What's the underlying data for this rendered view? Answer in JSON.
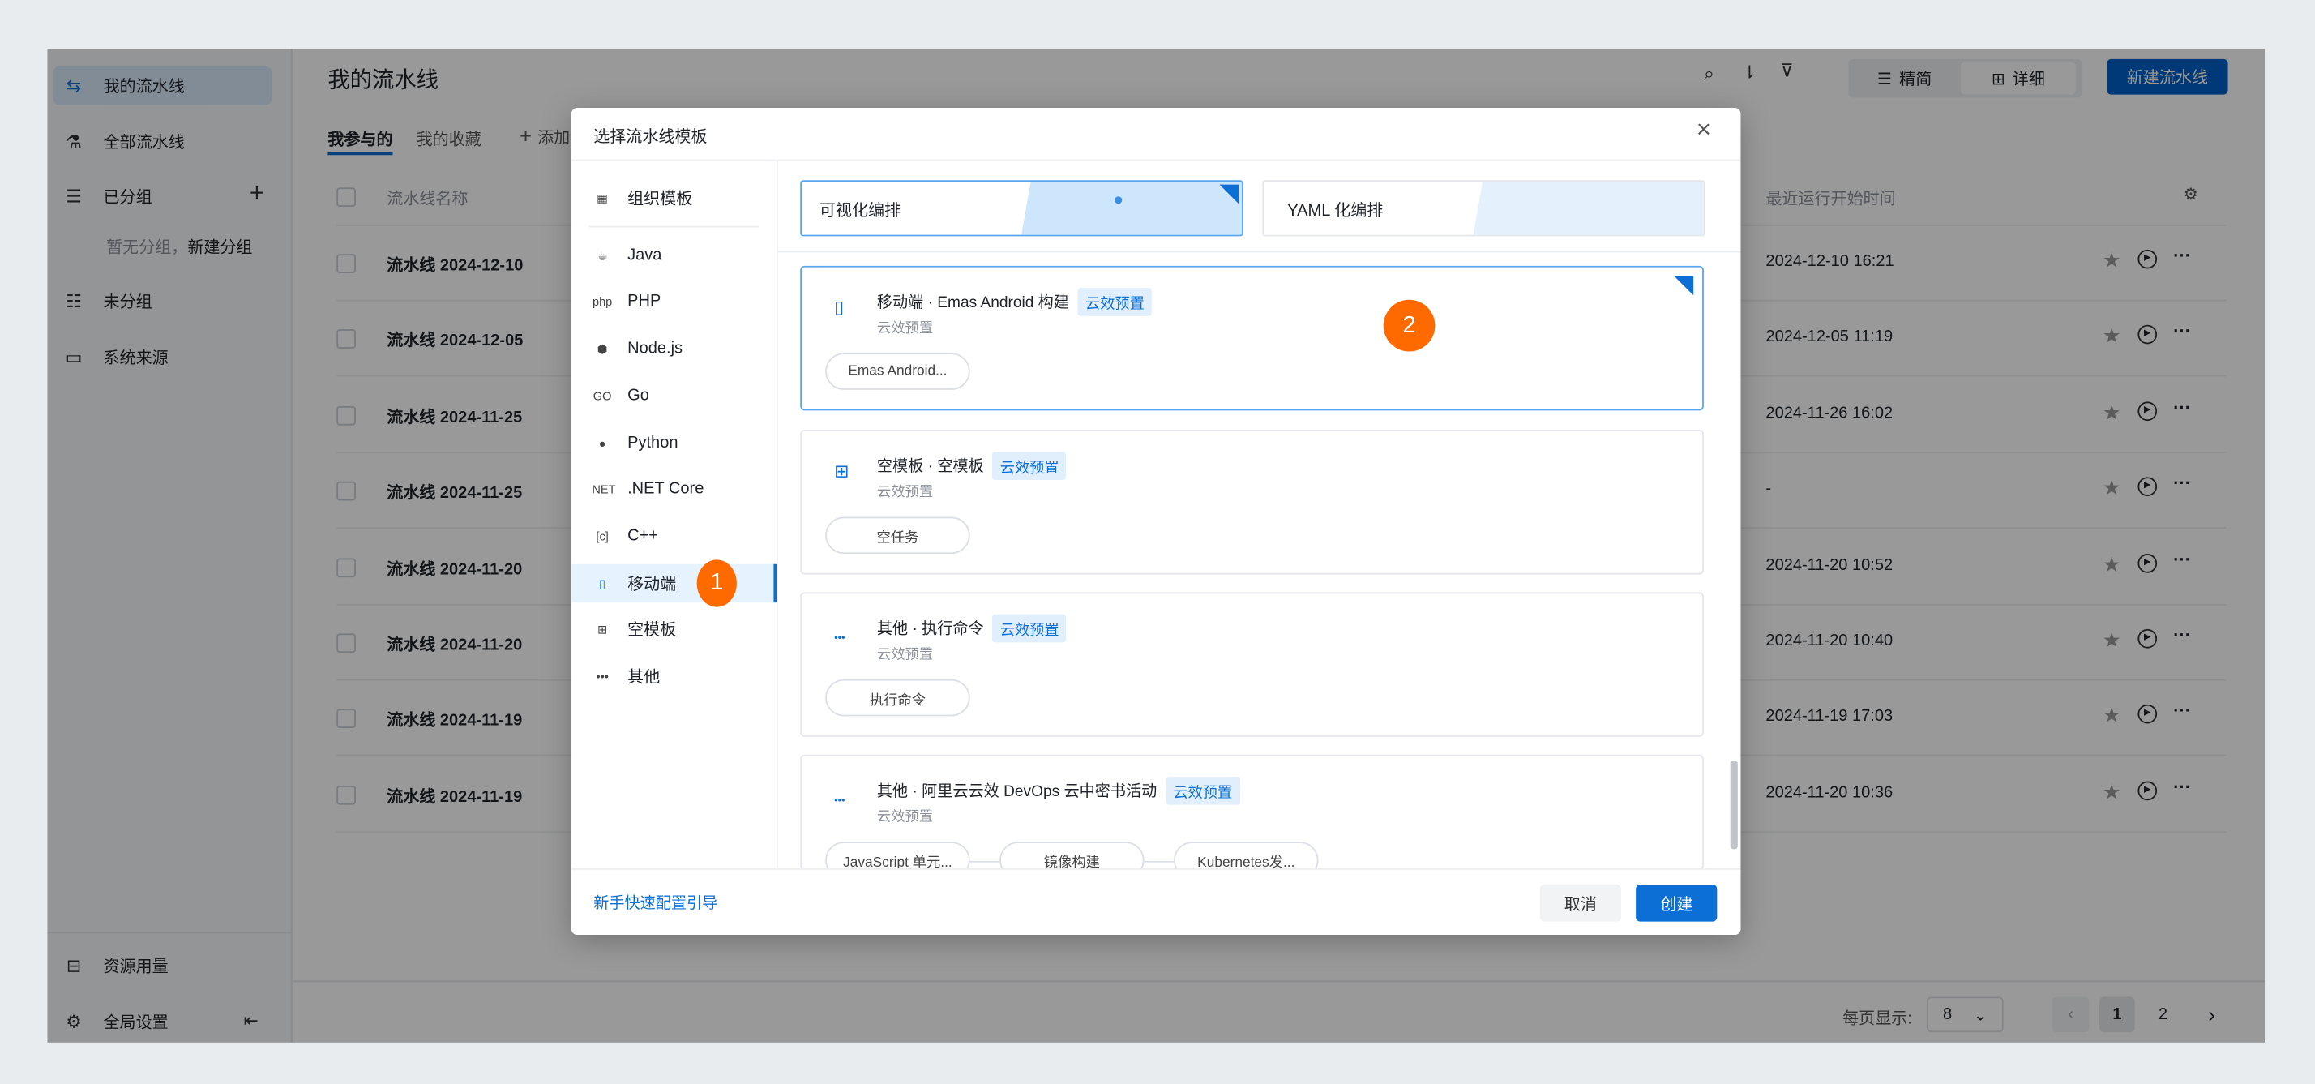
{
  "colors": {
    "accent": "#0b6fd6",
    "primary_button": "#0060c6",
    "step_badge": "#ff6a00",
    "background": "#e8ecef"
  },
  "sidebar": {
    "items": [
      {
        "label": "我的流水线",
        "icon": "pipeline-icon",
        "active": true
      },
      {
        "label": "全部流水线",
        "icon": "flask-icon"
      },
      {
        "label": "已分组",
        "icon": "group-list-icon"
      },
      {
        "label": "未分组",
        "icon": "ungrouped-icon"
      },
      {
        "label": "系统来源",
        "icon": "monitor-icon"
      }
    ],
    "empty_group_text": "暂无分组，",
    "new_group_link": "新建分组",
    "bottom": [
      {
        "label": "资源用量",
        "icon": "inbox-icon"
      },
      {
        "label": "全局设置",
        "icon": "settings-icon"
      }
    ]
  },
  "header": {
    "title": "我的流水线",
    "tabs": [
      {
        "label": "我参与的",
        "active": true
      },
      {
        "label": "我的收藏"
      }
    ],
    "add_tab": "添加",
    "view_toggle": [
      {
        "label": "精简",
        "icon": "list-icon"
      },
      {
        "label": "详细",
        "icon": "grid-icon",
        "active": true
      }
    ],
    "new_pipeline": "新建流水线"
  },
  "table": {
    "columns": {
      "name": "流水线名称",
      "last_run": "最近运行开始时间"
    },
    "rows": [
      {
        "name": "流水线 2024-12-10",
        "last_run": "2024-12-10 16:21"
      },
      {
        "name": "流水线 2024-12-05",
        "last_run": "2024-12-05 11:19"
      },
      {
        "name": "流水线 2024-11-25",
        "last_run": "2024-11-26 16:02"
      },
      {
        "name": "流水线 2024-11-25",
        "last_run": "-"
      },
      {
        "name": "流水线 2024-11-20",
        "last_run": "2024-11-20 10:52"
      },
      {
        "name": "流水线 2024-11-20",
        "last_run": "2024-11-20 10:40"
      },
      {
        "name": "流水线 2024-11-19",
        "last_run": "2024-11-19 17:03"
      },
      {
        "name": "流水线 2024-11-19",
        "last_run": "2024-11-20 10:36"
      }
    ]
  },
  "pagination": {
    "page_size_label": "每页显示:",
    "page_size": "8",
    "pages": [
      "1",
      "2"
    ],
    "current": "1"
  },
  "modal": {
    "title": "选择流水线模板",
    "nav": [
      {
        "label": "组织模板",
        "icon": "grid-icon",
        "glyph": "▦"
      },
      {
        "label": "Java",
        "icon": "java-icon",
        "glyph": "☕"
      },
      {
        "label": "PHP",
        "icon": "php-icon",
        "glyph": "php"
      },
      {
        "label": "Node.js",
        "icon": "nodejs-icon",
        "glyph": "⬢"
      },
      {
        "label": "Go",
        "icon": "go-icon",
        "glyph": "GO"
      },
      {
        "label": "Python",
        "icon": "python-icon",
        "glyph": "●"
      },
      {
        "label": ".NET Core",
        "icon": "dotnet-icon",
        "glyph": "NET"
      },
      {
        "label": "C++",
        "icon": "cpp-icon",
        "glyph": "[c]"
      },
      {
        "label": "移动端",
        "icon": "mobile-icon",
        "glyph": "▯",
        "active": true
      },
      {
        "label": "空模板",
        "icon": "blank-template-icon",
        "glyph": "⊞"
      },
      {
        "label": "其他",
        "icon": "more-icon",
        "glyph": "•••"
      }
    ],
    "modes": [
      {
        "label": "可视化编排",
        "selected": true
      },
      {
        "label": "YAML 化编排"
      }
    ],
    "templates": [
      {
        "title": "移动端 · Emas Android 构建",
        "badge": "云效预置",
        "sub": "云效预置",
        "icon": "mobile-icon",
        "glyph": "▯",
        "steps": [
          "Emas Android..."
        ],
        "selected": true
      },
      {
        "title": "空模板 · 空模板",
        "badge": "云效预置",
        "sub": "云效预置",
        "icon": "blank-template-icon",
        "glyph": "⊞",
        "steps": [
          "空任务"
        ]
      },
      {
        "title": "其他 · 执行命令",
        "badge": "云效预置",
        "sub": "云效预置",
        "icon": "more-icon",
        "glyph": "•••",
        "steps": [
          "执行命令"
        ]
      },
      {
        "title": "其他 · 阿里云云效 DevOps 云中密书活动",
        "badge": "云效预置",
        "sub": "云效预置",
        "icon": "more-icon",
        "glyph": "•••",
        "steps": [
          "JavaScript 单元...",
          "镜像构建",
          "Kubernetes发..."
        ]
      }
    ],
    "guide_link": "新手快速配置引导",
    "cancel": "取消",
    "create": "创建"
  },
  "step_markers": [
    "1",
    "2"
  ]
}
